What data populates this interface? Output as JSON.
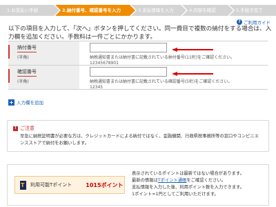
{
  "steps": [
    {
      "label": "1.お支払い手続"
    },
    {
      "label": "2.納付番号、確認番号を入力"
    },
    {
      "label": "3.支払情報を入力"
    },
    {
      "label": "4.内容を確認"
    },
    {
      "label": "5.手続き完了"
    }
  ],
  "guide_label": "ご利用ガイド",
  "intro": "以下の項目を入力して、「次へ」ボタンを押してください。同一費目で複数の納付をする場合は、入力欄を追加ください。手数料は一件ごとにかかります。",
  "fields": [
    {
      "label": "納付番号",
      "sub": "(半角)",
      "value": "",
      "hint": "納税通知書または納付書に記載されている納付番号(11桁)をご確認ください。",
      "example": "12345678901"
    },
    {
      "label": "確認番号",
      "sub": "(半角)",
      "value": "",
      "hint": "納税通知書または納付書に記載されている確認番号(5桁)をご確認ください。",
      "example": "12345"
    }
  ],
  "add_row_label": "入力欄を追加",
  "notice": {
    "title": "ご注意",
    "text": "早急に納税証明書が必要な方は、クレジットカードによる納付ではなく、金融機関、行政県税事務所等の窓口やコンビニエンスストアで納付をお願いします。"
  },
  "points": {
    "label": "利用可能Tポイント",
    "value": "1015ポイント",
    "info_1": "表示されているポイントは最新ではない場合があります。",
    "info_2_prefix": "最新の情報は",
    "info_2_link": "Tポイント通帳",
    "info_2_suffix": "をご確認ください。",
    "info_3": "支払情報を入力した後、利用ポイント数を入力できます。",
    "info_4": "1ポイント=1円としてご利用いただけます。"
  },
  "colors": {
    "accent": "#f08c00",
    "link": "#1a5fb4",
    "alert": "#c62828"
  }
}
